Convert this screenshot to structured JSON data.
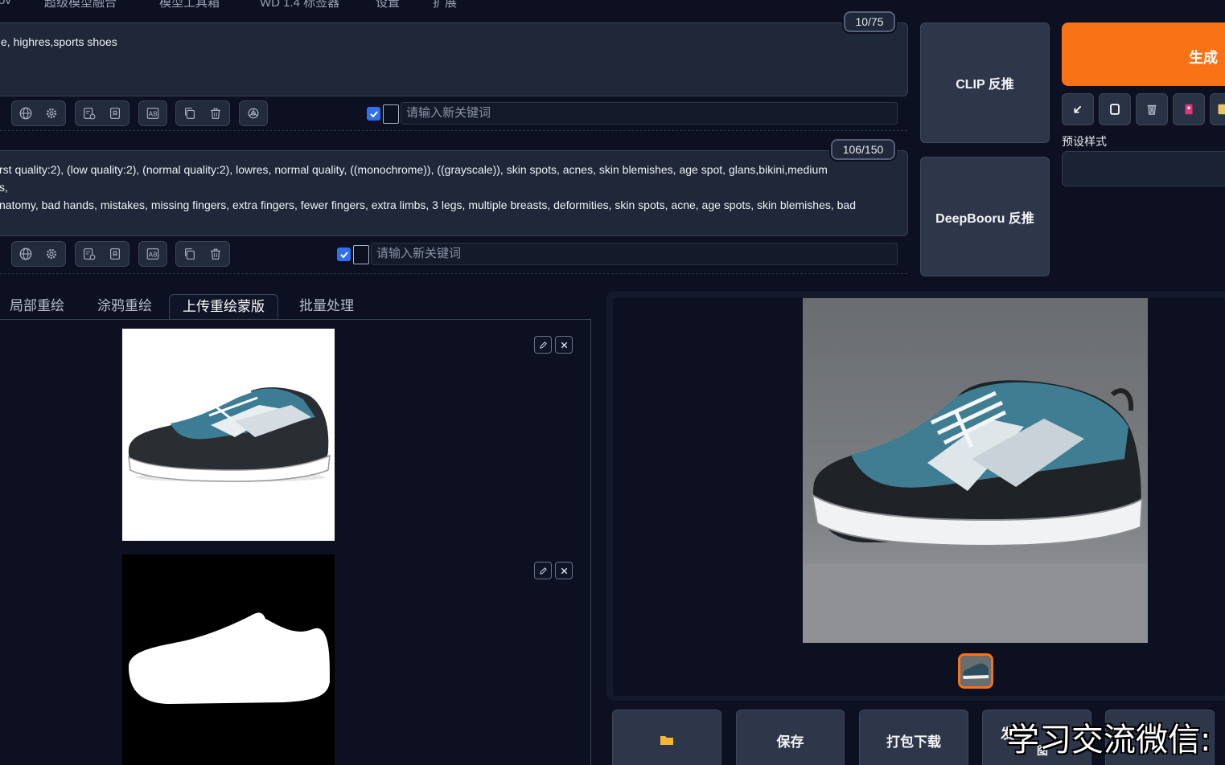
{
  "top_nav": [
    "ov",
    "超级模型融合",
    "模型工具箱",
    "WD 1.4 标签器",
    "设置",
    "扩展"
  ],
  "positive_prompt": {
    "text": "e, highres,sports shoes",
    "counter": "10/75",
    "keyword_placeholder": "请输入新关键词"
  },
  "negative_prompt": {
    "line1": "rst quality:2), (low quality:2), (normal quality:2), lowres, normal quality, ((monochrome)), ((grayscale)), skin spots, acnes, skin blemishes, age spot, glans,bikini,medium",
    "line2": "s,",
    "line3": "natomy, bad hands, mistakes, missing fingers, extra fingers, fewer fingers, extra limbs, 3 legs, multiple breasts, deformities, skin spots, acne, age spots, skin blemishes, bad",
    "counter": "106/150",
    "keyword_placeholder": "请输入新关键词"
  },
  "buttons": {
    "clip": "CLIP 反推",
    "deepbooru": "DeepBooru 反推",
    "generate": "生成",
    "preset_label": "预设样式"
  },
  "tabs": [
    "局部重绘",
    "涂鸦重绘",
    "上传重绘蒙版",
    "批量处理"
  ],
  "actions": [
    "保存",
    "打包下载",
    "发送到图",
    ""
  ],
  "action_partial": [
    "发",
    "图"
  ],
  "watermark": "学习交流微信:",
  "colors": {
    "accent": "#f97316",
    "background": "#0c1021",
    "panel": "#1f2738",
    "checkbox": "#2f6ff0"
  },
  "icons": [
    "globe-icon",
    "gear-icon",
    "list-clock-icon",
    "bookmark-icon",
    "ab-translate-icon",
    "copy-icon",
    "trash-icon",
    "openai-icon",
    "folder-icon"
  ]
}
